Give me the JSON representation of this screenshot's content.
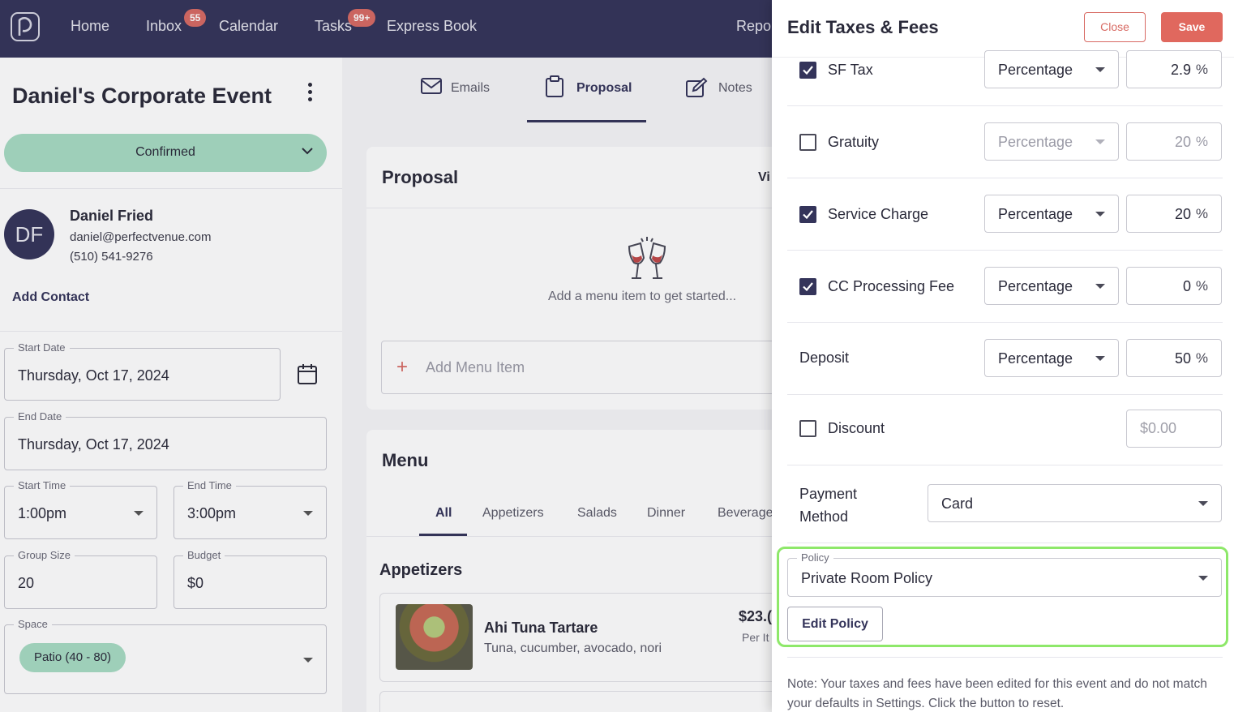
{
  "nav": {
    "items": [
      "Home",
      "Inbox",
      "Calendar",
      "Tasks",
      "Express Book",
      "Repo"
    ],
    "inbox_badge": "55",
    "tasks_badge": "99+"
  },
  "event": {
    "title": "Daniel's Corporate Event",
    "status": "Confirmed",
    "contact": {
      "initials": "DF",
      "name": "Daniel Fried",
      "email": "daniel@perfectvenue.com",
      "phone": "(510) 541-9276"
    },
    "add_contact": "Add Contact",
    "start_date": {
      "label": "Start Date",
      "value": "Thursday, Oct 17, 2024"
    },
    "end_date": {
      "label": "End Date",
      "value": "Thursday, Oct 17, 2024"
    },
    "start_time": {
      "label": "Start Time",
      "value": "1:00pm"
    },
    "end_time": {
      "label": "End Time",
      "value": "3:00pm"
    },
    "group_size": {
      "label": "Group Size",
      "value": "20"
    },
    "budget": {
      "label": "Budget",
      "value": "$0"
    },
    "space": {
      "label": "Space",
      "value": "Patio (40 - 80)"
    }
  },
  "tabs": [
    "Emails",
    "Proposal",
    "Notes"
  ],
  "proposal": {
    "title": "Proposal",
    "view_link": "Vi",
    "empty_text": "Add a menu item to get started...",
    "add_menu_item": "Add Menu Item"
  },
  "menu": {
    "title": "Menu",
    "tabs": [
      "All",
      "Appetizers",
      "Salads",
      "Dinner",
      "Beverage"
    ],
    "section": "Appetizers",
    "items": [
      {
        "name": "Ahi Tuna Tartare",
        "desc": "Tuna, cucumber, avocado, nori",
        "price": "$23.(",
        "unit": "Per It"
      }
    ]
  },
  "drawer": {
    "title": "Edit Taxes & Fees",
    "close": "Close",
    "save": "Save",
    "rows": [
      {
        "label": "SF Tax",
        "checked": true,
        "type": "Percentage",
        "value": "2.9",
        "unit": "%"
      },
      {
        "label": "Gratuity",
        "checked": false,
        "type": "Percentage",
        "value": "20",
        "unit": "%"
      },
      {
        "label": "Service Charge",
        "checked": true,
        "type": "Percentage",
        "value": "20",
        "unit": "%"
      },
      {
        "label": "CC Processing Fee",
        "checked": true,
        "type": "Percentage",
        "value": "0",
        "unit": "%"
      },
      {
        "label": "Deposit",
        "type": "Percentage",
        "value": "50",
        "unit": "%"
      }
    ],
    "discount": {
      "label": "Discount",
      "checked": false,
      "placeholder": "$0.00"
    },
    "payment_method": {
      "label_line1": "Payment",
      "label_line2": "Method",
      "value": "Card"
    },
    "policy": {
      "label": "Policy",
      "value": "Private Room Policy",
      "edit_button": "Edit Policy"
    },
    "note": "Note: Your taxes and fees have been edited for this event and do not match your defaults in Settings. Click the button to reset."
  },
  "colors": {
    "navy": "#34345a",
    "accent": "#e0685e",
    "confirmed": "#a7dcc3",
    "highlight": "#8ee86a"
  }
}
